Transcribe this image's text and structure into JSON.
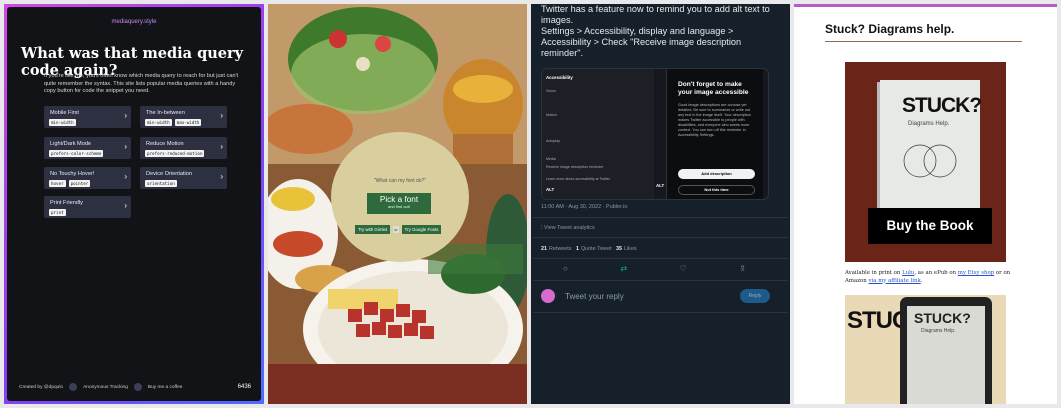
{
  "media_query": {
    "site": "mediaquery.style",
    "title": "What was that media query code again?",
    "intro": "If you're like me, you'll often know which media query to reach for but just can't quite remember the syntax. This site lists popular media queries with a handy copy button for code the snippet you need.",
    "cards": [
      {
        "title": "Mobile First",
        "chips": [
          "min-width"
        ]
      },
      {
        "title": "The In-between",
        "chips": [
          "min-width",
          "max-width"
        ]
      },
      {
        "title": "Light/Dark Mode",
        "chips": [
          "prefers-color-scheme"
        ]
      },
      {
        "title": "Reduce Motion",
        "chips": [
          "prefers-reduced-motion"
        ]
      },
      {
        "title": "No Touchy Hover!",
        "chips": [
          "hover",
          "pointer"
        ]
      },
      {
        "title": "Device Orientation",
        "chips": [
          "orientation"
        ]
      },
      {
        "title": "Print Friendly",
        "chips": [
          "print"
        ]
      }
    ],
    "footer": {
      "created": "Created by @dpqulo",
      "tracking": "Anonymous Tracking",
      "coffee": "Buy me a coffee",
      "count": "6436"
    }
  },
  "font_ad": {
    "question": "\"What can my font do?\"",
    "pick_title": "Pick a font",
    "pick_sub": "and find out!",
    "try_gimlet": "Try with Gimlet",
    "or": "or",
    "try_google": "Try Google Fonts"
  },
  "twitter": {
    "tweet": "Twitter has a feature now to remind you to add alt text to images.\nSettings > Accessibility, display and language > Accessibility > Check \"Receive image description reminder\".",
    "shot": {
      "left_rows": [
        "Accessibility",
        "Vision",
        "Motion",
        "Autoplay",
        "Media",
        "Receive image description reminder",
        "Learn more about accessibility at Twitter",
        "ALT"
      ],
      "modal_title": "Don't forget to make your image accessible",
      "modal_text": "Good image descriptions are concise yet detailed. Be sure to summarize or write out any text in the image itself. Your description makes Twitter accessible to people with disabilities, and everyone who wants more context. You can turn off this reminder in Accessibility Settings.",
      "add_description": "Add description",
      "not_this_time": "Not this time",
      "alt": "ALT"
    },
    "meta": "11:00 AM · Aug 30, 2022 · Publer.io",
    "analytics": "View Tweet analytics",
    "retweets": "21",
    "retweets_label": "Retweets",
    "quote": "1",
    "quote_label": "Quote Tweet",
    "likes": "35",
    "likes_label": "Likes",
    "reply_placeholder": "Tweet your reply",
    "reply_button": "Reply"
  },
  "stuck": {
    "heading": "Stuck? Diagrams help.",
    "cover_title": "STUCK?",
    "cover_sub": "Diagrams Help.",
    "buy": "Buy the Book",
    "avail_pre": "Available in print on ",
    "lulu": "Lulu",
    "avail_mid": ", as an ePub on ",
    "etsy": "my Etsy shop",
    "avail_mid2": " or on Amazon ",
    "affiliate": "via my affiliate link",
    "avail_end": ".",
    "photo_title": "STUCK?",
    "screen_title": "STUCK?",
    "screen_sub": "Diagrams Help."
  }
}
